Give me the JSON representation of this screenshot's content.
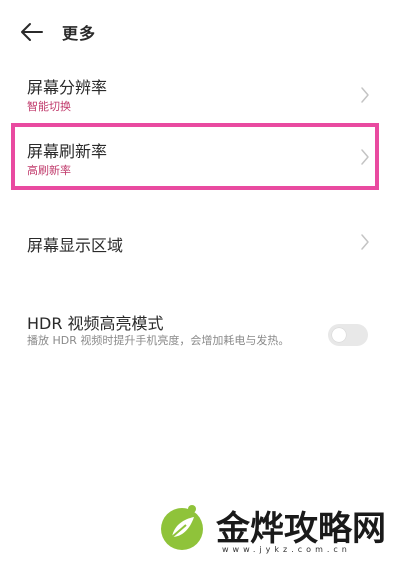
{
  "colors": {
    "accent": "#c03a6b",
    "highlight_border": "#e94aa0",
    "chevron": "#c4c4c4",
    "logo_green": "#8fc33a"
  },
  "header": {
    "back_icon": "arrow-left-icon",
    "title": "更多"
  },
  "settings": {
    "resolution": {
      "title": "屏幕分辨率",
      "value": "智能切换"
    },
    "refresh_rate": {
      "title": "屏幕刷新率",
      "value": "高刷新率"
    },
    "display_area": {
      "title": "屏幕显示区域"
    },
    "hdr": {
      "title": "HDR 视频高亮模式",
      "description": "播放 HDR 视频时提升手机亮度，会增加耗电与发热。",
      "enabled": false
    }
  },
  "watermark": {
    "text": "金烨攻略网",
    "url": "www.jykz.com.cn"
  }
}
